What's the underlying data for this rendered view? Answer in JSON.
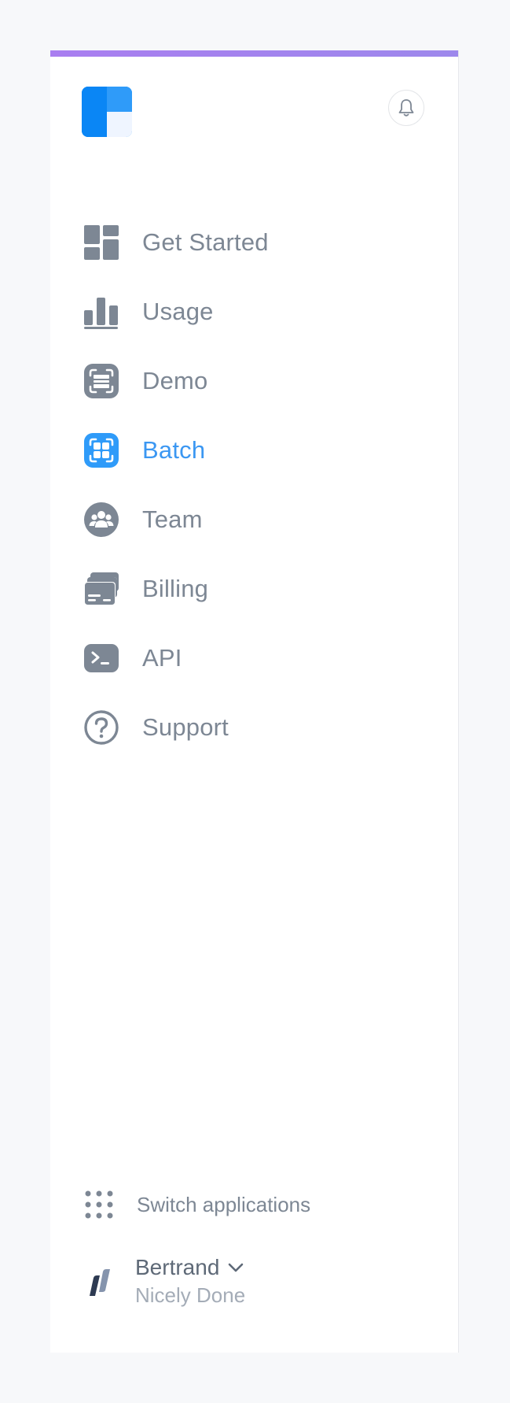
{
  "sidebar": {
    "brand_colors": {
      "primary": "#0a86f5",
      "light": "#2f9bf9",
      "pale": "#eff5ff"
    },
    "accent_bar_color": "#a97ef0",
    "notifications_icon": "bell-icon",
    "items": [
      {
        "label": "Get Started",
        "icon": "dashboard-icon",
        "active": false
      },
      {
        "label": "Usage",
        "icon": "bar-chart-icon",
        "active": false
      },
      {
        "label": "Demo",
        "icon": "scan-document-icon",
        "active": false
      },
      {
        "label": "Batch",
        "icon": "batch-grid-icon",
        "active": true
      },
      {
        "label": "Team",
        "icon": "team-icon",
        "active": false
      },
      {
        "label": "Billing",
        "icon": "credit-card-icon",
        "active": false
      },
      {
        "label": "API",
        "icon": "terminal-icon",
        "active": false
      },
      {
        "label": "Support",
        "icon": "help-circle-icon",
        "active": false
      }
    ],
    "switch_label": "Switch applications",
    "account": {
      "name": "Bertrand",
      "organization": "Nicely Done"
    },
    "colors": {
      "text": "#7d8794",
      "active": "#3b97f2",
      "icon": "#7d8794"
    }
  }
}
